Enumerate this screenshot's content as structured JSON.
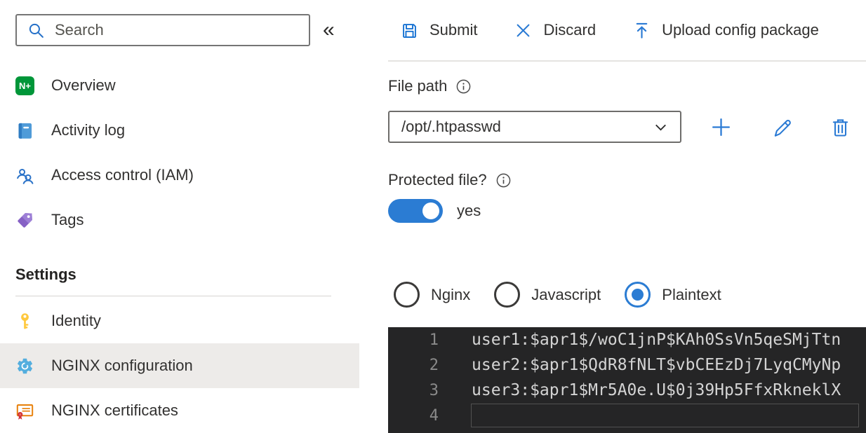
{
  "sidebar": {
    "search": {
      "placeholder": "Search"
    },
    "collapse_glyph": "«",
    "nav_items": [
      {
        "label": "Overview",
        "icon": "nginx-logo-icon",
        "logo_text": "N+"
      },
      {
        "label": "Activity log",
        "icon": "activity-log-icon"
      },
      {
        "label": "Access control (IAM)",
        "icon": "access-control-icon"
      },
      {
        "label": "Tags",
        "icon": "tags-icon"
      }
    ],
    "section_header": "Settings",
    "settings_items": [
      {
        "label": "Identity",
        "icon": "key-icon",
        "selected": false
      },
      {
        "label": "NGINX configuration",
        "icon": "gear-icon",
        "selected": true
      },
      {
        "label": "NGINX certificates",
        "icon": "certificate-icon",
        "selected": false
      }
    ]
  },
  "toolbar": {
    "submit_label": "Submit",
    "discard_label": "Discard",
    "upload_label": "Upload config package"
  },
  "file_path": {
    "label": "File path",
    "value": "/opt/.htpasswd"
  },
  "protected_file": {
    "label": "Protected file?",
    "state_label": "yes",
    "enabled": true
  },
  "syntax_options": [
    {
      "label": "Nginx",
      "selected": false
    },
    {
      "label": "Javascript",
      "selected": false
    },
    {
      "label": "Plaintext",
      "selected": true
    }
  ],
  "editor": {
    "lines": [
      {
        "number": 1,
        "content": "user1:$apr1$/woC1jnP$KAh0SsVn5qeSMjTtn"
      },
      {
        "number": 2,
        "content": "user2:$apr1$QdR8fNLT$vbCEEzDj7LyqCMyNp"
      },
      {
        "number": 3,
        "content": "user3:$apr1$Mr5A0e.U$0j39Hp5FfxRkneklX"
      },
      {
        "number": 4,
        "content": ""
      }
    ]
  },
  "colors": {
    "accent": "#2b7cd3",
    "toolbar_icon_blue": "#1873d3",
    "selected_item_background": "#edebe9",
    "editor_background": "#252526",
    "nginx_green": "#009639"
  }
}
